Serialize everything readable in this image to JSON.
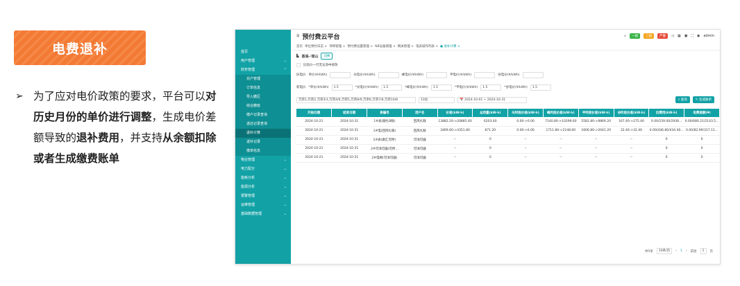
{
  "tag": "电费退补",
  "desc": {
    "p1": "为了应对电价政策的要求，平台可以",
    "b1": "对历史月份的单价进行调整",
    "p2": "，生成电价差额导致的",
    "b2": "退补费用",
    "p3": "，并支持",
    "b3": "从余额扣除或者生成缴费账单"
  },
  "app": {
    "title": "预付费云平台",
    "user": "admin",
    "badges": [
      "一级",
      "二级",
      "严重"
    ]
  },
  "sidebar": [
    {
      "label": "首页"
    },
    {
      "label": "用户管理",
      "ch": "⌄"
    },
    {
      "label": "财务管理",
      "ch": "⌃"
    },
    {
      "label": "充户管理",
      "sub": 1
    },
    {
      "label": "订单信息",
      "sub": 1
    },
    {
      "label": "导入撤区",
      "sub": 1
    },
    {
      "label": "综合撤班",
      "sub": 1
    },
    {
      "label": "缴户记录查询",
      "sub": 1
    },
    {
      "label": "退还记录查询",
      "sub": 1
    },
    {
      "label": "退补计算",
      "sub": 1,
      "active": 1
    },
    {
      "label": "退补记录",
      "sub": 1
    },
    {
      "label": "缴单信息",
      "sub": 1
    },
    {
      "label": "物业管理",
      "ch": "⌄"
    },
    {
      "label": "电力配分",
      "ch": "⌄"
    },
    {
      "label": "能耗分析",
      "ch": "⌄"
    },
    {
      "label": "能源分析",
      "ch": "⌄"
    },
    {
      "label": "报警管理",
      "ch": "⌄"
    },
    {
      "label": "运维管理",
      "ch": "⌄"
    },
    {
      "label": "基础数据管理",
      "ch": "⌄"
    }
  ],
  "tabs": [
    "首页",
    "单位预付日志 ×",
    "项目管理 ×",
    "预付费设置管理 ×",
    "NB设备管理 ×",
    "网关管理 ×",
    "电表操作列表 ×",
    "● 退补计算 ×"
  ],
  "crumb": "香溪-·瑶山",
  "crumb_btn": "切换",
  "checkbox": "比较价一行无法添中修改",
  "old_row": [
    "旧电价",
    "单价(¥/kWh)",
    "",
    "尖电价(¥/kWh)",
    "",
    "峰电价(¥/kWh)",
    "",
    "平电价(¥/kWh)",
    "",
    "谷电价(¥/kWh)",
    ""
  ],
  "new_row": [
    "新电价",
    "*单价(¥/kWh)",
    "1.5",
    "*尖电价(¥/kWh)",
    "1.5",
    "*峰电价(¥/kWh)",
    "1.5",
    "*平电价(¥/kWh)",
    "1.5",
    "*谷电价(¥/kWh)",
    "1.5"
  ],
  "filter": {
    "select": "万宗1,万宗2,万宗3/1,万宗4/6,万宗5,万宗8/9,万宗6,万宗7/8,万宗10/8",
    "num": "10台",
    "dates": [
      "2024-10-01",
      "~",
      "2024-10-31"
    ],
    "query": "查询",
    "gen": "生成账单"
  },
  "table": {
    "headers": [
      "开始日期",
      "结束日期",
      "表编号",
      "用户名",
      "价差(kW-h)",
      "总用量(kW-h)",
      "尖时段价差(kW-h)",
      "峰时段价差(kW-h)",
      "平时段价差(kW-h)",
      "谷时段价差(kW-h)",
      "旧费用(kW-h)",
      "电费差额(¥)"
    ],
    "rows": [
      [
        "2024-10-21",
        "2024-10-31",
        "1#表(跟扎B联)",
        "回风扎联",
        "13882.20->20885.60",
        "6203.40",
        "0.00->0.00",
        "7140.80->10299.60",
        "5582.80->8869.20",
        "167.40->275.40",
        "0.00/159.00/2936...",
        "0.00/680.21/2143.5..."
      ],
      [
        "2024-10-21",
        "2024-10-31",
        "1#电(回风扎联)",
        "回风扎联",
        "3469.60->4351.80",
        "871.20",
        "0.00->0.00",
        "1711.80->2148.60",
        "1606.80->2041.20",
        "32.40->32.40",
        "0.00/436.80/434.40...",
        "0.00/82.99/317.11..."
      ],
      [
        "2024-10-21",
        "2024-10-31",
        "2#表(跟汇可所)",
        "可洋可器",
        "--",
        "0",
        "--",
        "--",
        "--",
        "--",
        "0",
        "0"
      ],
      [
        "2024-10-21",
        "2024-10-31",
        "2#可洋可器(可所...",
        "可洋可器",
        "--",
        "0",
        "--",
        "--",
        "--",
        "--",
        "0",
        "0"
      ],
      [
        "2024-10-21",
        "2024-10-31",
        "2#电梯(可洋可器)",
        "可洋可器",
        "--",
        "0",
        "--",
        "--",
        "--",
        "--",
        "0",
        "0"
      ]
    ]
  },
  "pager": [
    "共5条",
    "10条/页",
    "‹",
    "1",
    "›",
    "前往",
    "1",
    "页"
  ],
  "colors": {
    "accent": "#12a2a6",
    "tag": "#f37a35"
  }
}
